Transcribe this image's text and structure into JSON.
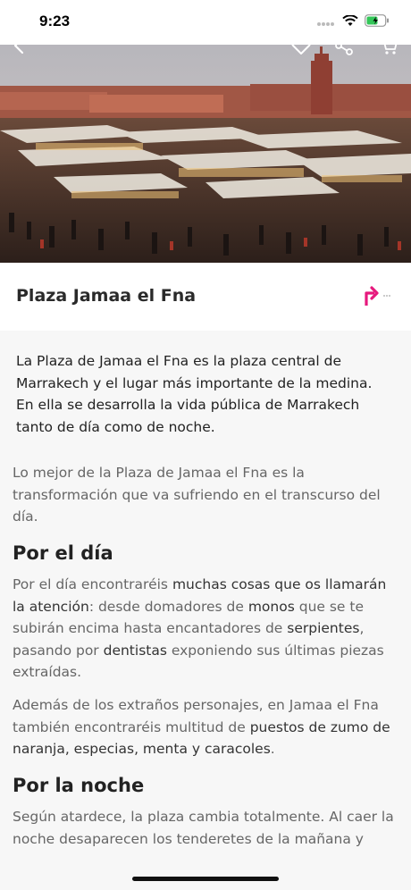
{
  "status_bar": {
    "time": "9:23"
  },
  "place": {
    "title": "Plaza Jamaa el Fna",
    "intro": "La Plaza de Jamaa el Fna es la plaza central de Marrakech y el lugar más importante de la medina. En ella se desarrolla la vida pública de Marrakech tanto de día como de noche."
  },
  "body": {
    "p1": "Lo mejor de la Plaza de Jamaa el Fna es la transformación que va sufriendo en el transcurso del día.",
    "h_day": "Por el día",
    "p2": {
      "t1": "Por el día encontraréis ",
      "b1": "muchas cosas que os llamarán la atención",
      "t2": ": desde domadores de ",
      "b2": "monos",
      "t3": " que se te subirán encima hasta encantadores de ",
      "b3": "serpientes",
      "t4": ", pasando por ",
      "b4": "dentistas",
      "t5": " exponiendo sus últimas piezas extraídas."
    },
    "p3": {
      "t1": "Además de los extraños personajes, en Jamaa el Fna también encontraréis multitud de ",
      "b1": "puestos de zumo de naranja, especias, menta y caracoles",
      "t2": "."
    },
    "h_night": "Por la noche",
    "p4": "Según atardece, la plaza cambia totalmente. Al caer la noche desaparecen los tenderetes de la mañana y"
  },
  "colors": {
    "accent": "#e6197d",
    "text": "#222222",
    "muted": "#666666"
  },
  "icons": [
    "back-icon",
    "heart-icon",
    "share-icon",
    "cart-icon",
    "directions-icon"
  ]
}
